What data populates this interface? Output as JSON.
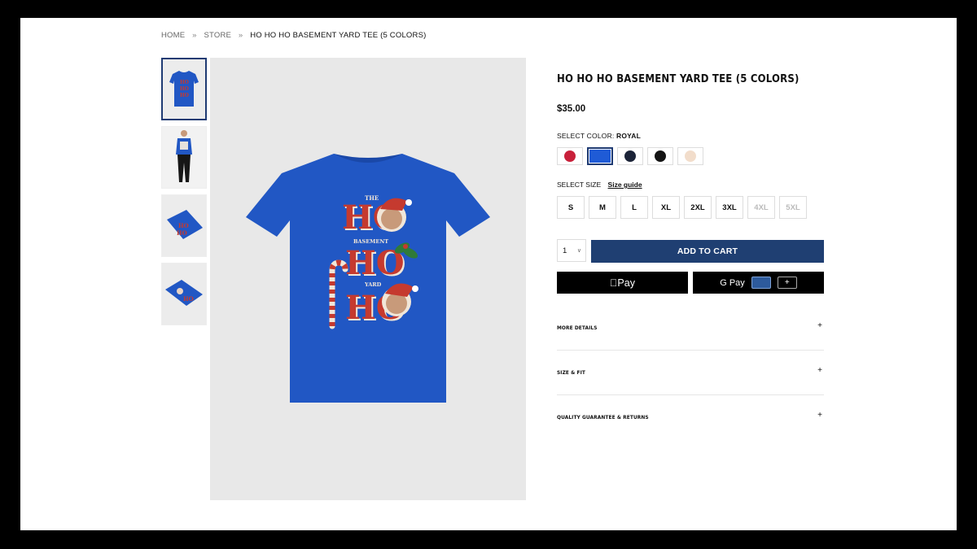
{
  "breadcrumb": {
    "home": "HOME",
    "sep1": "»",
    "store": "STORE",
    "sep2": "»",
    "current": "HO HO HO BASEMENT YARD TEE (5 COLORS)"
  },
  "product": {
    "title": "HO HO HO BASEMENT YARD TEE (5 COLORS)",
    "price": "$35.00",
    "shirt_color": "#2157c4"
  },
  "color": {
    "label": "SELECT COLOR:",
    "selected": "ROYAL",
    "swatches": [
      {
        "name": "red",
        "hex": "#c8203a"
      },
      {
        "name": "royal",
        "hex": "#1f5bd6"
      },
      {
        "name": "navy",
        "hex": "#1c2438"
      },
      {
        "name": "black",
        "hex": "#141414"
      },
      {
        "name": "natural",
        "hex": "#f2ddcb"
      }
    ]
  },
  "size": {
    "label": "SELECT SIZE",
    "guide": "Size guide",
    "options": [
      "S",
      "M",
      "L",
      "XL",
      "2XL",
      "3XL",
      "4XL",
      "5XL"
    ],
    "unavailable": [
      "4XL",
      "5XL"
    ]
  },
  "cart": {
    "qty": "1",
    "add_label": "ADD TO CART"
  },
  "pay": {
    "apple": "Pay",
    "google": "G Pay",
    "plus": "+"
  },
  "accordion": [
    {
      "label": "MORE DETAILS",
      "icon": "+"
    },
    {
      "label": "SIZE & FIT",
      "icon": "+"
    },
    {
      "label": "QUALITY GUARANTEE & RETURNS",
      "icon": "+"
    }
  ],
  "shirt_print": {
    "line1": "HO",
    "line2": "HO",
    "line3": "HO",
    "small1": "THE",
    "small2": "BASEMENT",
    "small3": "YARD"
  },
  "colors": {
    "accent": "#1f3f72",
    "ho_red": "#c53a2f"
  }
}
